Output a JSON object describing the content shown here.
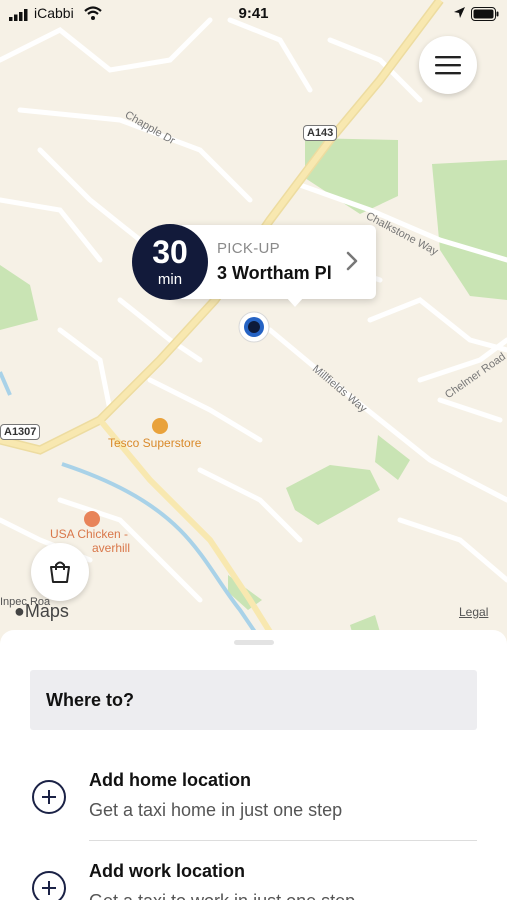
{
  "status_bar": {
    "carrier": "iCabbi",
    "time": "9:41"
  },
  "map": {
    "labels": {
      "chapple": "Chapple Dr",
      "chalkstone": "Chalkstone Way",
      "millfields": "Millfields Way",
      "chelmer": "Chelmer Road",
      "a143": "A143",
      "a1307": "A1307",
      "tesco": "Tesco Superstore",
      "usa_chicken_1": "USA Chicken -",
      "usa_chicken_2": "averhill",
      "inpec": "Inpec Roa"
    },
    "maps_logo": "Maps",
    "legal": "Legal"
  },
  "pickup": {
    "eta_value": "30",
    "eta_unit": "min",
    "label": "PICK-UP",
    "address": "3 Wortham Pl"
  },
  "sheet": {
    "search_placeholder": "Where to?",
    "home_title": "Add home location",
    "home_sub": "Get a taxi home in just one step",
    "work_title": "Add work location",
    "work_sub": "Get a taxi to work in just one step"
  },
  "colors": {
    "accent": "#121a3a",
    "map_bg": "#f6f1e6",
    "main_road": "#f7e3a0",
    "park": "#c9e4b4",
    "water": "#a9d2e8"
  },
  "icons": [
    "menu-icon",
    "chevron-right-icon",
    "basket-icon",
    "location-arrow-icon",
    "wifi-icon",
    "battery-icon",
    "plus-icon",
    "apple-icon"
  ]
}
